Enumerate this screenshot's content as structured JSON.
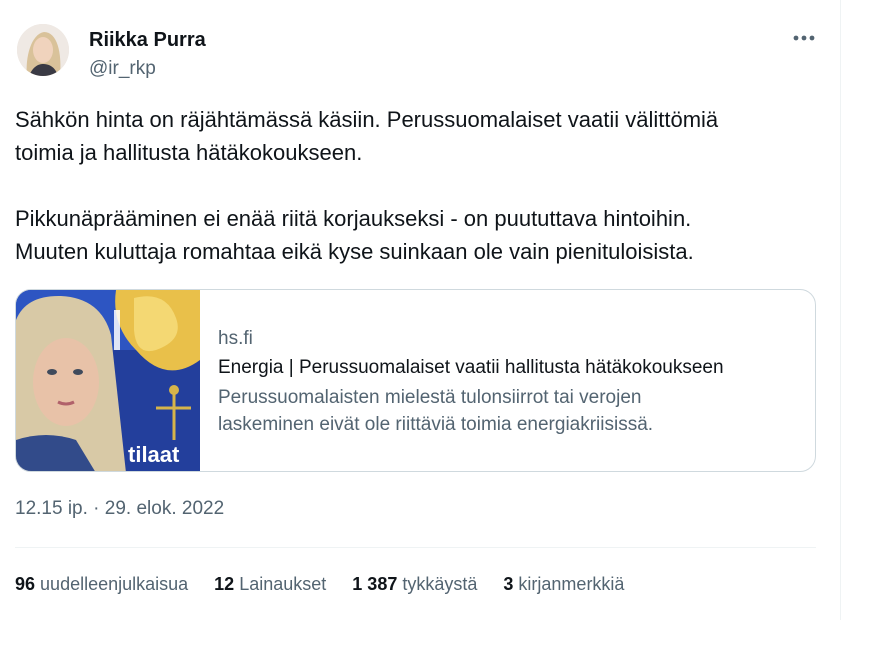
{
  "author": {
    "display_name": "Riikka Purra",
    "handle": "@ir_rkp"
  },
  "tweet": {
    "paragraphs": [
      "Sähkön hinta on räjähtämässä käsiin. Perussuomalaiset vaatii välittömiä\ntoimia ja hallitusta hätäkokoukseen.",
      "Pikkunäprääminen ei enää riitä korjaukseksi - on puututtava hintoihin.\nMuuten kuluttaja romahtaa eikä kyse suinkaan ole vain pienituloisista."
    ]
  },
  "link_card": {
    "domain": "hs.fi",
    "title": "Energia | Perussuomalaiset vaatii hallitusta hätäkokoukseen",
    "description": "Perussuomalaisten mielestä tulonsiirrot tai verojen\nlaskeminen eivät ole riittäviä toimia energiakriisissä.",
    "thumbnail_caption": "tilaat"
  },
  "timestamp": "12.15 ip. · 29. elok. 2022",
  "stats": [
    {
      "count": "96",
      "label": "uudelleenjulkaisua"
    },
    {
      "count": "12",
      "label": "Lainaukset"
    },
    {
      "count": "1 387",
      "label": "tykkäystä"
    },
    {
      "count": "3",
      "label": "kirjanmerkkiä"
    }
  ],
  "icons": {
    "more": "more-horizontal-icon"
  },
  "colors": {
    "text_primary": "#0f1419",
    "text_secondary": "#536471",
    "border": "#cfd9de"
  }
}
